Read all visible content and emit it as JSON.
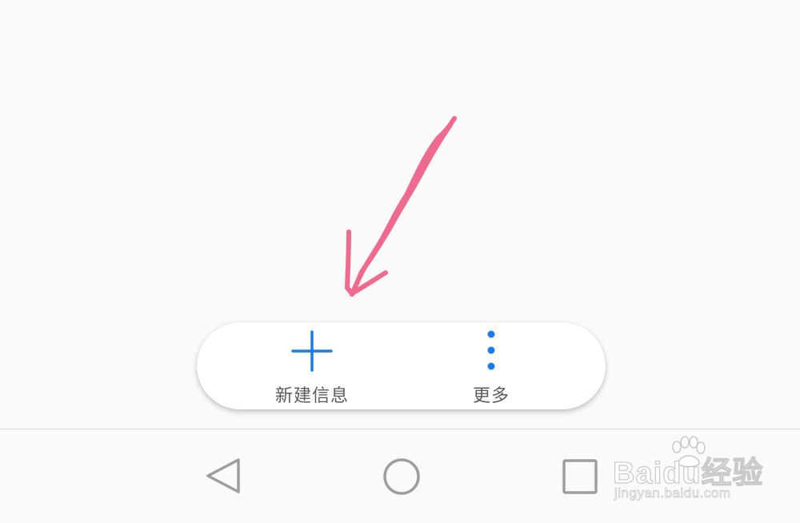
{
  "actions": {
    "new_message": {
      "label": "新建信息",
      "icon": "plus-icon"
    },
    "more": {
      "label": "更多",
      "icon": "more-vertical-icon"
    }
  },
  "nav": {
    "back_icon": "back-triangle-icon",
    "home_icon": "home-circle-icon",
    "recent_icon": "recent-square-icon"
  },
  "watermark": {
    "main": "Baidu经验",
    "sub": "jingyan.baidu.com"
  },
  "colors": {
    "accent": "#1a7ce6",
    "annotation": "#f06a8f",
    "label": "#5b5b5b",
    "nav_icon": "#9e9e9e",
    "background": "#fafafa"
  }
}
